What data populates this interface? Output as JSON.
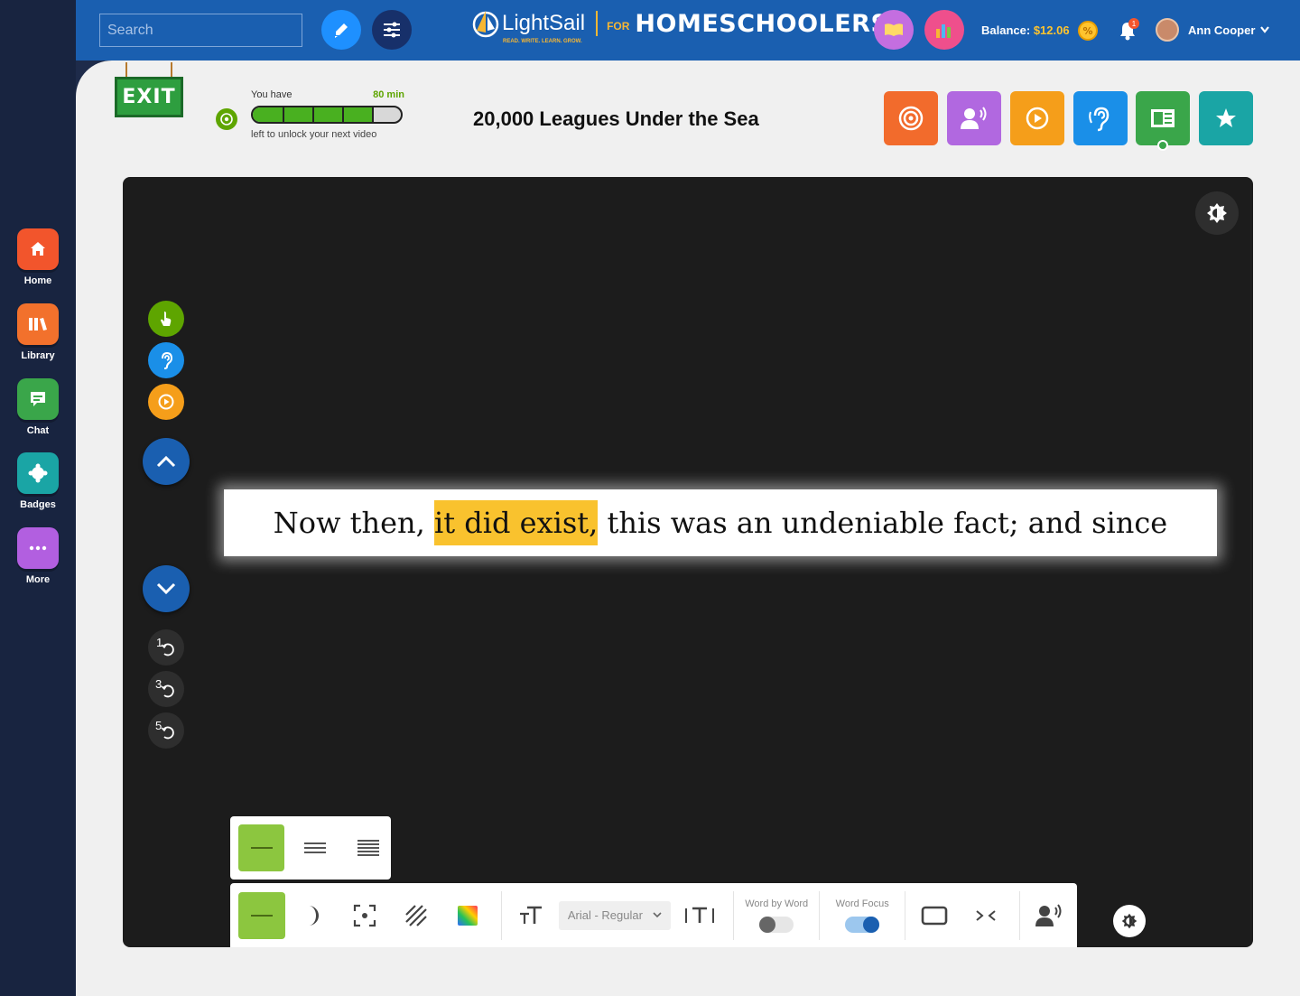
{
  "nav": [
    {
      "label": "Home",
      "icon": "home-icon",
      "color": "#f2552c"
    },
    {
      "label": "Library",
      "icon": "library-icon",
      "color": "#f2712c"
    },
    {
      "label": "Chat",
      "icon": "chat-icon",
      "color": "#3aa64a"
    },
    {
      "label": "Badges",
      "icon": "badge-icon",
      "color": "#1aa5a5"
    },
    {
      "label": "More",
      "icon": "more-icon",
      "color": "#b25fe0"
    }
  ],
  "header": {
    "search_placeholder": "Search",
    "logo_text": "LightSail",
    "logo_tagline": "READ. WRITE. LEARN. GROW.",
    "logo_for": "FOR",
    "logo_audience": "HOMESCHOOLERS",
    "balance_label": "Balance:",
    "balance_amount": "$12.06",
    "notification_count": "1",
    "user_name": "Ann Cooper"
  },
  "progress": {
    "prefix": "You have",
    "minutes": "80 min",
    "suffix": "left to unlock your next video",
    "fraction": 0.82
  },
  "book": {
    "title": "20,000 Leagues Under the Sea"
  },
  "tools": [
    {
      "icon": "target-icon",
      "color": "#f26b2c"
    },
    {
      "icon": "read-aloud-icon",
      "color": "#b168e0"
    },
    {
      "icon": "play-icon",
      "color": "#f59e1a"
    },
    {
      "icon": "listen-icon",
      "color": "#1a8fe8"
    },
    {
      "icon": "book-view-icon",
      "color": "#3aa64a"
    },
    {
      "icon": "star-icon",
      "color": "#1aa5a5"
    }
  ],
  "reader": {
    "before": "Now then, ",
    "highlight": "it did exist,",
    "after": " this was an undeniable fact; and since",
    "rewind_labels": [
      "1",
      "3",
      "5"
    ]
  },
  "toolbar": {
    "font": "Arial - Regular",
    "word_by_word_label": "Word by Word",
    "word_by_word_on": false,
    "word_focus_label": "Word Focus",
    "word_focus_on": true
  },
  "colors": {
    "accent_green": "#8cc63f",
    "highlight": "#f9c22e",
    "header_blue": "#1a5fb0"
  }
}
